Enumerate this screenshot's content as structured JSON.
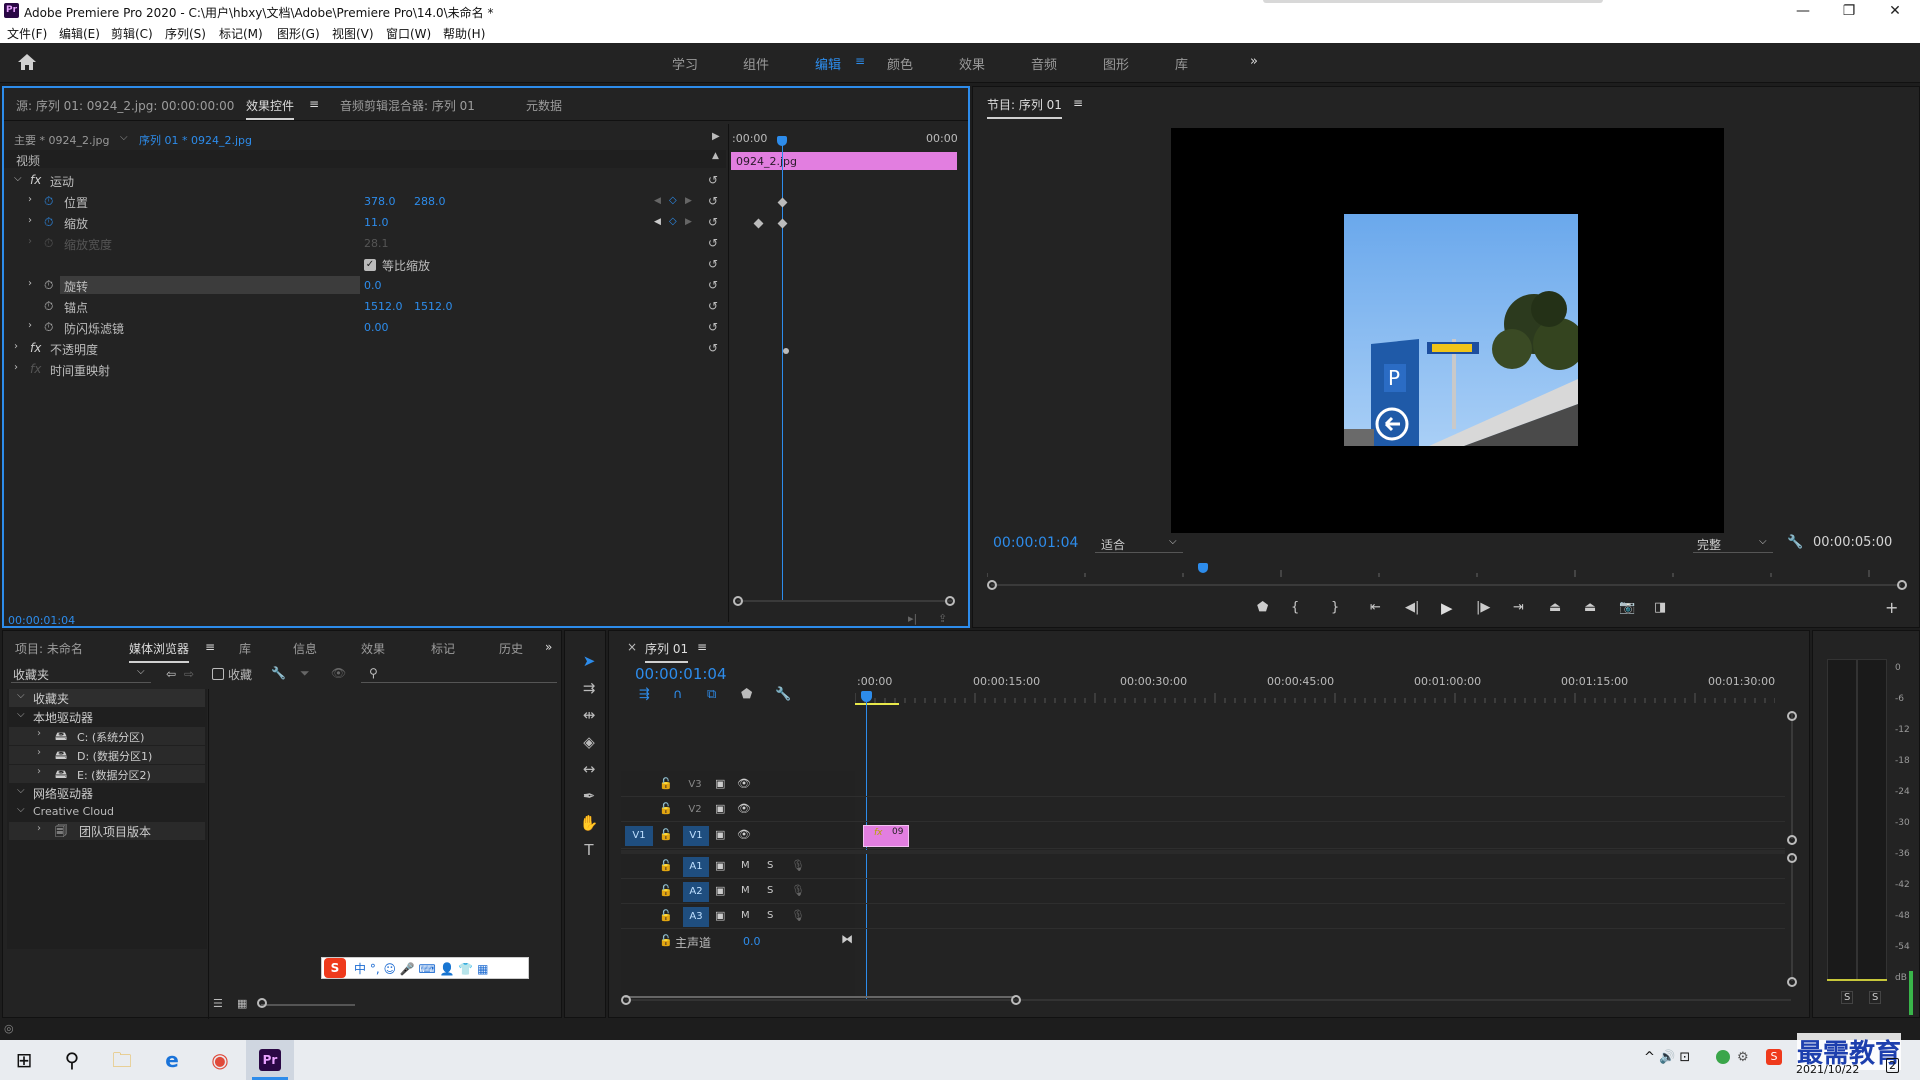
{
  "window": {
    "app_icon": "Pr",
    "title": "Adobe Premiere Pro 2020 - C:\\用户\\hbxy\\文档\\Adobe\\Premiere Pro\\14.0\\未命名 *",
    "minimize": "—",
    "restore": "❐",
    "close": "✕"
  },
  "menu": [
    "文件(F)",
    "编辑(E)",
    "剪辑(C)",
    "序列(S)",
    "标记(M)",
    "图形(G)",
    "视图(V)",
    "窗口(W)",
    "帮助(H)"
  ],
  "workspaces": {
    "items": [
      "学习",
      "组件",
      "编辑",
      "颜色",
      "效果",
      "音频",
      "图形",
      "库"
    ],
    "active": "编辑",
    "more": "»"
  },
  "effect_panel": {
    "tabs": [
      "源: 序列 01: 0924_2.jpg: 00:00:00:00",
      "效果控件",
      "音频剪辑混合器: 序列 01",
      "元数据"
    ],
    "master_label": "主要 * 0924_2.jpg",
    "sequence_label": "序列 01 * 0924_2.jpg",
    "ruler_start": ":00:00",
    "ruler_end": "00:00",
    "clip_name": "0924_2.jpg",
    "section_video": "视频",
    "fx_motion": "运动",
    "position_label": "位置",
    "position_x": "378.0",
    "position_y": "288.0",
    "scale_label": "缩放",
    "scale_value": "11.0",
    "scale_width_label": "缩放宽度",
    "scale_width_value": "28.1",
    "uniform_scale_label": "等比缩放",
    "rotation_label": "旋转",
    "rotation_value": "0.0",
    "anchor_label": "锚点",
    "anchor_x": "1512.0",
    "anchor_y": "1512.0",
    "flicker_label": "防闪烁滤镜",
    "flicker_value": "0.00",
    "opacity_label": "不透明度",
    "time_remap_label": "时间重映射",
    "fx_symbol": "fx",
    "timecode": "00:00:01:04"
  },
  "program_monitor": {
    "title": "节目: 序列 01",
    "timecode": "00:00:01:04",
    "fit_select": "适合",
    "quality_select": "完整",
    "duration": "00:00:05:00",
    "image_description_colors": {
      "sky": "#7eb6f2",
      "sign": "#1f5aa8",
      "tree": "#2d3b1c"
    }
  },
  "project_panel": {
    "tabs": [
      "项目: 未命名",
      "媒体浏览器",
      "库",
      "信息",
      "效果",
      "标记",
      "历史"
    ],
    "favorites_select": "收藏夹",
    "favorites_checkbox": "收藏",
    "tree": {
      "favorites": "收藏夹",
      "local_drives": "本地驱动器",
      "drive_c": "C: (系统分区)",
      "drive_d": "D: (数据分区1)",
      "drive_e": "E: (数据分区2)",
      "network": "网络驱动器",
      "creative_cloud": "Creative Cloud",
      "team_versions": "团队项目版本"
    },
    "ime_toolbar": "中 °, ☺ 🎤 ⌨ 👤 👕 ▦"
  },
  "timeline": {
    "tab": "序列 01",
    "timecode": "00:00:01:04",
    "ruler": [
      ":00:00",
      "00:00:15:00",
      "00:00:30:00",
      "00:00:45:00",
      "00:01:00:00",
      "00:01:15:00",
      "00:01:30:00"
    ],
    "tracks": {
      "v3": "V3",
      "v2": "V2",
      "v1_src": "V1",
      "v1": "V1",
      "a1": "A1",
      "a2": "A2",
      "a3": "A3",
      "m": "M",
      "s": "S",
      "master_label": "主声道",
      "master_value": "0.0"
    },
    "clip_label": "09",
    "clip_fx": "fx"
  },
  "audio_meter": {
    "scale": [
      "0",
      "-6",
      "-12",
      "-18",
      "-24",
      "-30",
      "-36",
      "-42",
      "-48",
      "-54",
      "dB"
    ],
    "solo_left": "S",
    "solo_right": "S"
  },
  "taskbar": {
    "start": "⊞",
    "search": "⚲",
    "tray_text": "^ 🔊 ⊡",
    "date": "2021/10/22",
    "watermark": "最需教育",
    "notif_count": "2"
  },
  "colors": {
    "accent": "#2d8ceb",
    "clip_pink": "#e27ee0",
    "panel_bg": "#232323"
  }
}
